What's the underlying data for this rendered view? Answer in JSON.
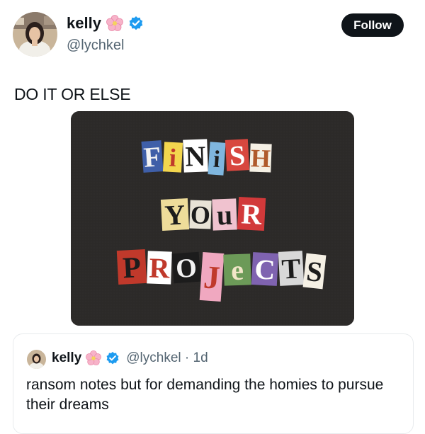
{
  "author": {
    "name": "kelly",
    "handle": "@lychkel",
    "emoji_icon": "cherry-blossom-icon",
    "badge_icon": "verified-badge-icon"
  },
  "follow_label": "Follow",
  "tweet": {
    "text": "DO IT OR ELSE"
  },
  "image": {
    "lines": [
      [
        "F",
        "i",
        "N",
        "i",
        "S",
        "H"
      ],
      [
        "Y",
        "O",
        "u",
        "R"
      ],
      [
        "P",
        "R",
        "O",
        "J",
        "e",
        "C",
        "T",
        "S"
      ]
    ]
  },
  "quoted": {
    "name": "kelly",
    "handle_time": "@lychkel · 1d",
    "text": "ransom notes but for demanding the homies to pursue their dreams"
  },
  "colors": {
    "follow_bg": "#0f1419",
    "verified": "#1d9bf0",
    "image_bg": "#2c2a29"
  }
}
